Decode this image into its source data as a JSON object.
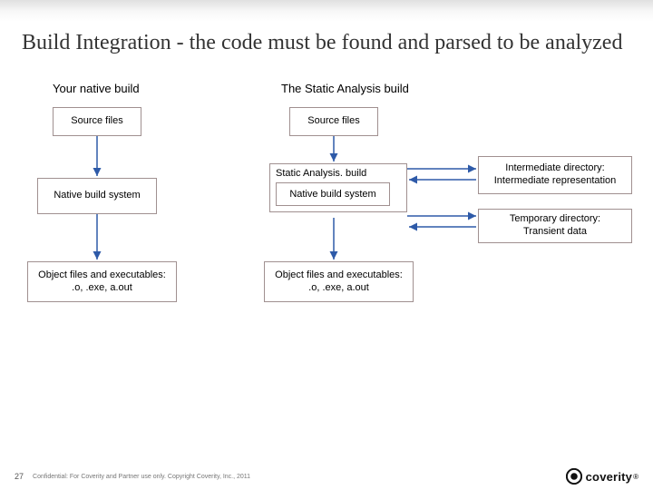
{
  "title": "Build Integration - the code must be found and parsed to be analyzed",
  "native": {
    "heading": "Your native build",
    "source": "Source files",
    "build": "Native build system",
    "output": "Object files and executables:\n.o, .exe, a.out"
  },
  "sa": {
    "heading": "The Static Analysis build",
    "source": "Source files",
    "wrapper": "Static Analysis. build",
    "inner": "Native build system",
    "output": "Object files and executables:\n.o, .exe, a.out",
    "intermediate": "Intermediate directory:\nIntermediate representation",
    "temporary": "Temporary directory:\nTransient data"
  },
  "footer": {
    "page": "27",
    "confidential": "Confidential: For Coverity and Partner use only. Copyright Coverity, Inc., 2011"
  },
  "brand": {
    "name": "coverity"
  }
}
